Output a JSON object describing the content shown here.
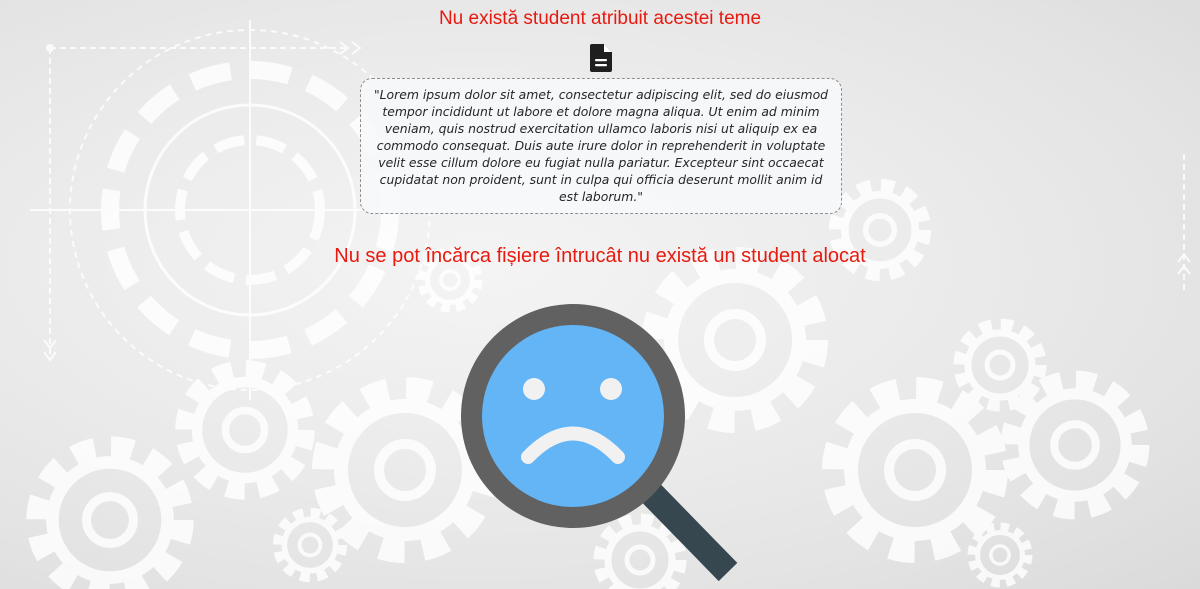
{
  "header": {
    "no_student_title": "Nu există student atribuit acestei teme"
  },
  "theme": {
    "document_icon": "file-text-icon",
    "description": "\"Lorem ipsum dolor sit amet, consectetur adipiscing elit, sed do eiusmod tempor incididunt ut labore et dolore magna aliqua. Ut enim ad minim veniam, quis nostrud exercitation ullamco laboris nisi ut aliquip ex ea commodo consequat. Duis aute irure dolor in reprehenderit in voluptate velit esse cillum dolore eu fugiat nulla pariatur. Excepteur sint occaecat cupidatat non proident, sunt in culpa qui officia deserunt mollit anim id est laborum.\""
  },
  "files": {
    "no_upload_message": "Nu se pot încărca fișiere întrucât nu există un student alocat"
  },
  "illustration": {
    "icon": "sad-magnifier-icon"
  },
  "colors": {
    "accent_red": "#e8190f",
    "face_blue": "#64b5f6",
    "ring_gray": "#616161",
    "handle_dark": "#37474f"
  }
}
